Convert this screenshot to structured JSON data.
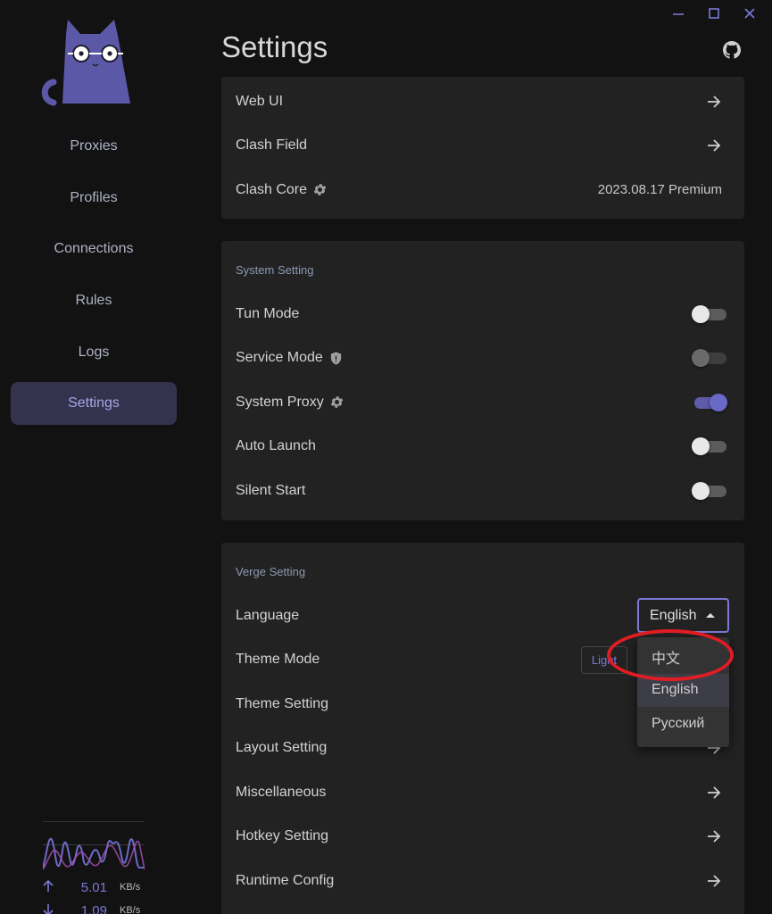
{
  "window": {
    "controls": [
      "minimize-icon",
      "maximize-icon",
      "close-icon"
    ]
  },
  "sidebar": {
    "items": [
      {
        "label": "Proxies"
      },
      {
        "label": "Profiles"
      },
      {
        "label": "Connections"
      },
      {
        "label": "Rules"
      },
      {
        "label": "Logs"
      },
      {
        "label": "Settings",
        "active": true
      }
    ],
    "traffic": {
      "up_value": "5.01",
      "up_unit": "KB/s",
      "down_value": "1.09",
      "down_unit": "KB/s"
    }
  },
  "page": {
    "title": "Settings"
  },
  "clash_card": {
    "web_ui": "Web UI",
    "clash_field": "Clash Field",
    "clash_core": "Clash Core",
    "clash_core_version": "2023.08.17 Premium"
  },
  "system_card": {
    "title": "System Setting",
    "tun_mode": "Tun Mode",
    "service_mode": "Service Mode",
    "system_proxy": "System Proxy",
    "auto_launch": "Auto Launch",
    "silent_start": "Silent Start",
    "states": {
      "tun_mode": false,
      "service_mode": false,
      "system_proxy": true,
      "auto_launch": false,
      "silent_start": false
    }
  },
  "verge_card": {
    "title": "Verge Setting",
    "language": "Language",
    "language_value": "English",
    "theme_mode": "Theme Mode",
    "theme_mode_value": "Light",
    "theme_setting": "Theme Setting",
    "layout_setting": "Layout Setting",
    "miscellaneous": "Miscellaneous",
    "hotkey_setting": "Hotkey Setting",
    "runtime_config": "Runtime Config"
  },
  "language_dropdown": {
    "options": [
      {
        "label": "中文"
      },
      {
        "label": "English",
        "selected": true
      },
      {
        "label": "Русский"
      }
    ]
  },
  "colors": {
    "accent": "#7b78d6",
    "annotation": "#e01c24",
    "card": "#222222",
    "background": "#121212"
  }
}
